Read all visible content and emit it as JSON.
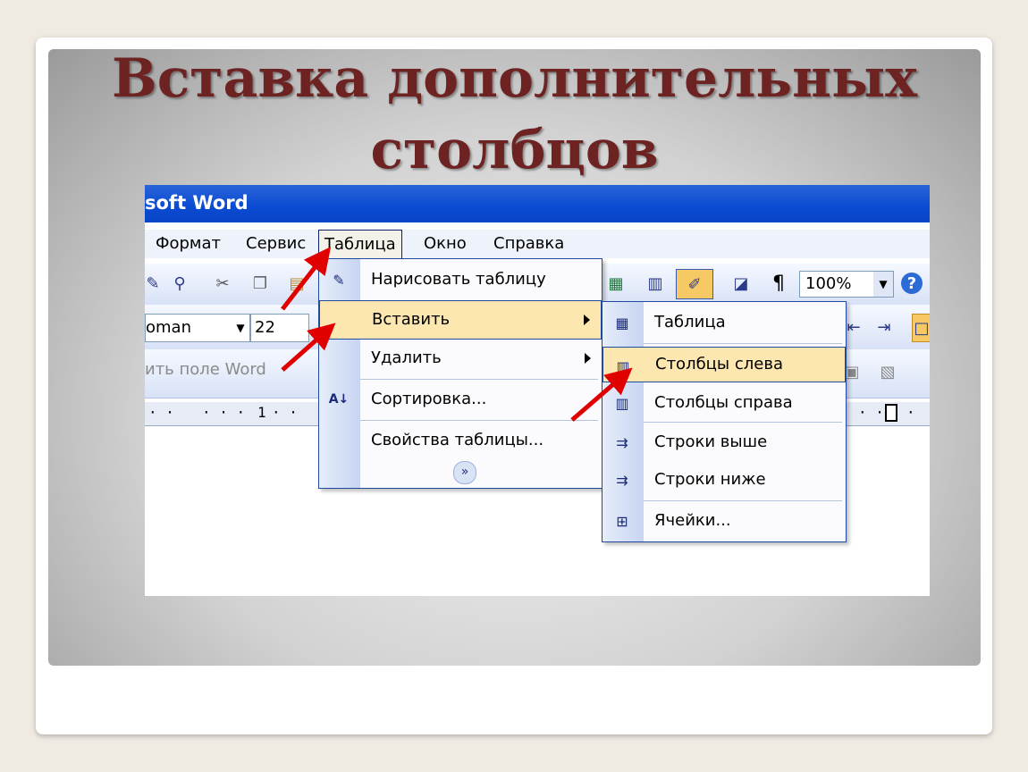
{
  "slide": {
    "title_line1": "Вставка дополнительных",
    "title_line2": "столбцов"
  },
  "window": {
    "title": "soft Word"
  },
  "menubar": {
    "items": [
      "Формат",
      "Сервис",
      "Таблица",
      "Окно",
      "Справка"
    ]
  },
  "toolbar": {
    "zoom": "100%",
    "font_name": "oman",
    "font_size": "22",
    "field_label": "ить поле Word"
  },
  "ruler": {
    "marker": "1"
  },
  "table_menu": {
    "items": [
      "Нарисовать таблицу",
      "Вставить",
      "Удалить",
      "Сортировка...",
      "Свойства таблицы..."
    ]
  },
  "insert_submenu": {
    "items": [
      "Таблица",
      "Столбцы слева",
      "Столбцы справа",
      "Строки выше",
      "Строки ниже",
      "Ячейки..."
    ]
  },
  "colors": {
    "title": "#6e2323",
    "titlebar": "#0a4ad2",
    "highlight": "#fde7b0",
    "arrow": "#e00000"
  }
}
